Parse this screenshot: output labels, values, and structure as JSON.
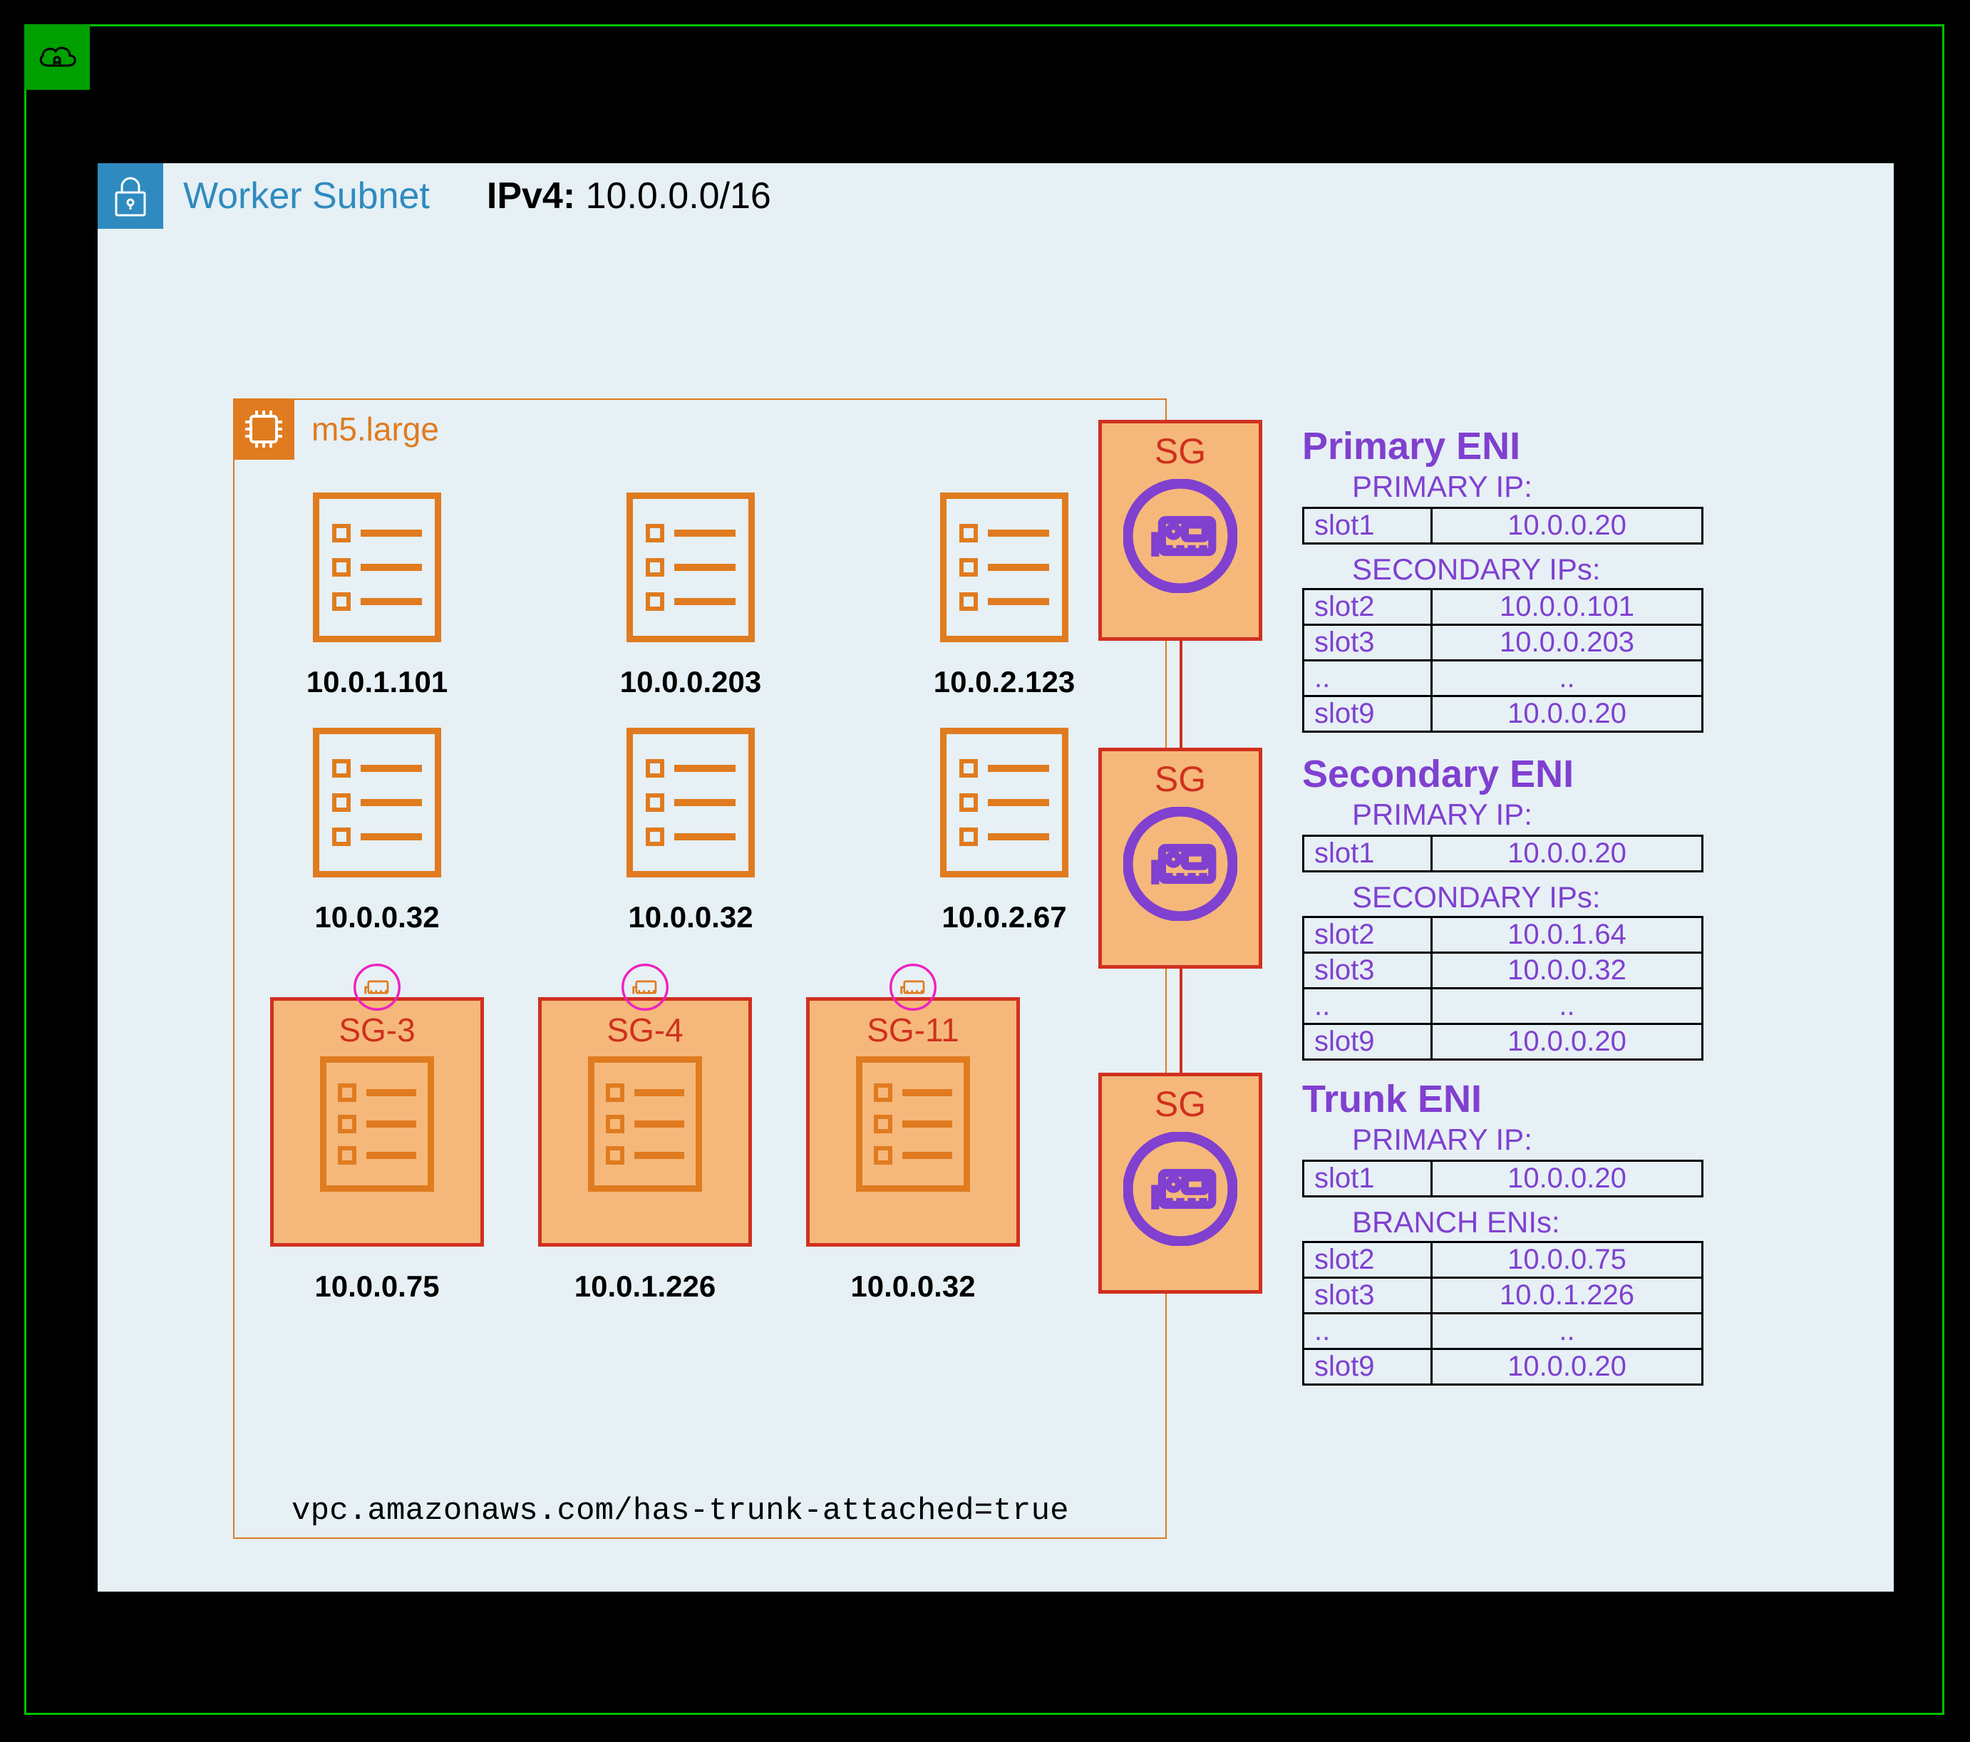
{
  "subnet": {
    "title": "Worker Subnet",
    "cidr_label": "IPv4:",
    "cidr": "10.0.0.0/16"
  },
  "instance": {
    "type": "m5.large",
    "tag": "vpc.amazonaws.com/has-trunk-attached=true",
    "pods_row1": [
      {
        "ip": "10.0.1.101"
      },
      {
        "ip": "10.0.0.203"
      },
      {
        "ip": "10.0.2.123"
      }
    ],
    "pods_row2": [
      {
        "ip": "10.0.0.32"
      },
      {
        "ip": "10.0.0.32"
      },
      {
        "ip": "10.0.2.67"
      }
    ],
    "sg_pods": [
      {
        "sg": "SG-3",
        "ip": "10.0.0.75"
      },
      {
        "sg": "SG-4",
        "ip": "10.0.1.226"
      },
      {
        "sg": "SG-11",
        "ip": "10.0.0.32"
      }
    ]
  },
  "enis": [
    {
      "sg_label": "SG",
      "title": "Primary ENI",
      "primary_label": "PRIMARY IP:",
      "primary": {
        "slot": "slot1",
        "ip": "10.0.0.20"
      },
      "secondary_label": "SECONDARY IPs:",
      "rows": [
        {
          "slot": "slot2",
          "ip": "10.0.0.101"
        },
        {
          "slot": "slot3",
          "ip": "10.0.0.203"
        },
        {
          "slot": "..",
          "ip": ".."
        },
        {
          "slot": "slot9",
          "ip": "10.0.0.20"
        }
      ]
    },
    {
      "sg_label": "SG",
      "title": "Secondary ENI",
      "primary_label": "PRIMARY IP:",
      "primary": {
        "slot": "slot1",
        "ip": "10.0.0.20"
      },
      "secondary_label": "SECONDARY IPs:",
      "rows": [
        {
          "slot": "slot2",
          "ip": "10.0.1.64"
        },
        {
          "slot": "slot3",
          "ip": "10.0.0.32"
        },
        {
          "slot": "..",
          "ip": ".."
        },
        {
          "slot": "slot9",
          "ip": "10.0.0.20"
        }
      ]
    },
    {
      "sg_label": "SG",
      "title": "Trunk ENI",
      "primary_label": "PRIMARY IP:",
      "primary": {
        "slot": "slot1",
        "ip": "10.0.0.20"
      },
      "secondary_label": "BRANCH ENIs:",
      "rows": [
        {
          "slot": "slot2",
          "ip": "10.0.0.75"
        },
        {
          "slot": "slot3",
          "ip": "10.0.1.226"
        },
        {
          "slot": "..",
          "ip": ".."
        },
        {
          "slot": "slot9",
          "ip": "10.0.0.20"
        }
      ]
    }
  ]
}
